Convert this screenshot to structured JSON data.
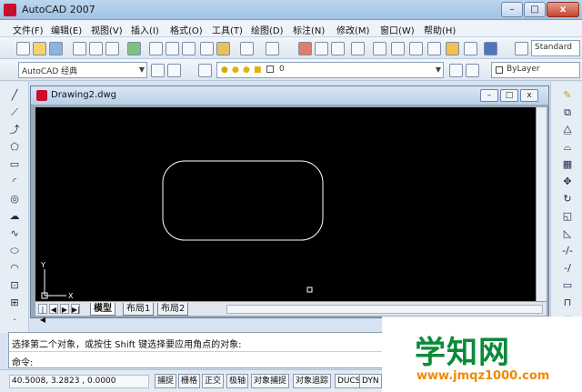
{
  "app": {
    "title": "AutoCAD 2007"
  },
  "window_controls": {
    "minimize": "–",
    "maximize": "□",
    "close": "x"
  },
  "menu": [
    {
      "label": "文件(F)"
    },
    {
      "label": "编辑(E)"
    },
    {
      "label": "视图(V)"
    },
    {
      "label": "插入(I)"
    },
    {
      "label": "格式(O)"
    },
    {
      "label": "工具(T)"
    },
    {
      "label": "绘图(D)"
    },
    {
      "label": "标注(N)"
    },
    {
      "label": "修改(M)"
    },
    {
      "label": "窗口(W)"
    },
    {
      "label": "帮助(H)"
    }
  ],
  "toolbar": {
    "workspace": "AutoCAD 经典",
    "layer_value": "0",
    "color_value": "ByLayer",
    "text_style": "Standard"
  },
  "drawing": {
    "title": "Drawing2.dwg",
    "ucs_x": "X",
    "ucs_y": "Y"
  },
  "layout_tabs": [
    {
      "label": "模型"
    },
    {
      "label": "布局1"
    },
    {
      "label": "布局2"
    }
  ],
  "command": {
    "line1": "选择第二个对象，或按住 Shift 键选择要应用角点的对象:",
    "prompt": "命令:"
  },
  "status": {
    "coordinates": "40.5008, 3.2823 , 0.0000",
    "buttons": [
      {
        "label": "捕捉"
      },
      {
        "label": "栅格"
      },
      {
        "label": "正交"
      },
      {
        "label": "极轴"
      },
      {
        "label": "对象捕捉"
      },
      {
        "label": "对象追踪"
      },
      {
        "label": "DUCS"
      },
      {
        "label": "DYN"
      }
    ]
  },
  "watermark": {
    "name": "学知网",
    "url": "www.jmqz1000.com"
  },
  "colors": {
    "canvas": "#000000",
    "title_bar": "#b8cfe7",
    "watermark_green": "#0a8a3a",
    "watermark_orange": "#f08a00"
  }
}
